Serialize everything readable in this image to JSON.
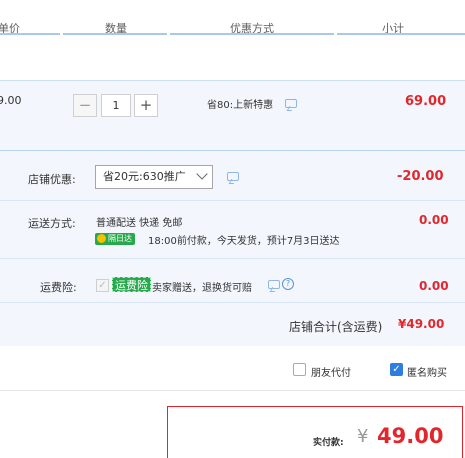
{
  "header": {
    "col_price": "单价",
    "col_qty": "数量",
    "col_promo": "优惠方式",
    "col_subtotal": "小计"
  },
  "item": {
    "unit_price": "9.00",
    "quantity": "1",
    "minus_symbol": "−",
    "plus_symbol": "+",
    "promo_text": "省80:上新特惠",
    "subtotal": "69.00"
  },
  "shop": {
    "discount_label": "店铺优惠:",
    "discount_selected": "省20元:630推广",
    "discount_amount": "-20.00",
    "shipping_label": "运送方式:",
    "shipping_method": "普通配送 快递 免邮",
    "shipping_badge": "隔日达",
    "shipping_note": "18:00前付款，今天发货，预计7月3日送达",
    "shipping_amount": "0.00",
    "insurance_label": "运费险:",
    "insurance_tag": "运费险",
    "insurance_desc": "卖家赠送，退换货可赔",
    "insurance_help": "?",
    "insurance_amount": "0.00",
    "total_label": "店铺合计(含运费)",
    "total_amount": "¥49.00"
  },
  "options": {
    "friend_pay_label": "朋友代付",
    "anonymous_label": "匿名购买",
    "anonymous_checked": true
  },
  "payment": {
    "label": "实付款:",
    "currency": "¥",
    "amount": "49.00"
  },
  "colors": {
    "accent_red": "#e2262b",
    "accent_blue": "#2e7ee2",
    "badge_green": "#28a84c",
    "panel_bg": "#f3f7fd"
  },
  "icons": [
    "message-icon",
    "help-icon",
    "check-icon",
    "lightning-icon",
    "chevron-down-icon"
  ]
}
